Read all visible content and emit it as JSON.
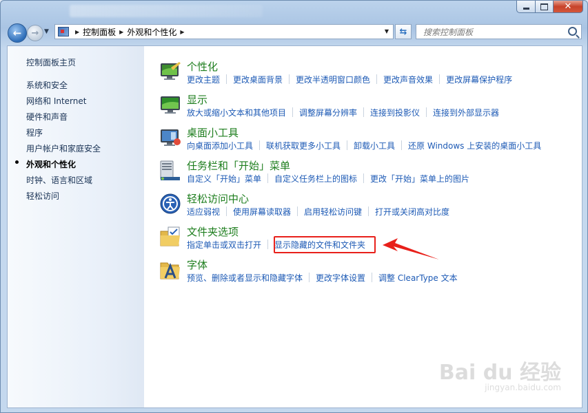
{
  "address": {
    "crumbs": [
      "控制面板",
      "外观和个性化"
    ]
  },
  "search": {
    "placeholder": "搜索控制面板"
  },
  "sidebar": {
    "home": "控制面板主页",
    "items": [
      "系统和安全",
      "网络和 Internet",
      "硬件和声音",
      "程序",
      "用户帐户和家庭安全",
      "外观和个性化",
      "时钟、语言和区域",
      "轻松访问"
    ],
    "active_index": 5
  },
  "categories": [
    {
      "title": "个性化",
      "icon": "personalization-icon",
      "links": [
        "更改主题",
        "更改桌面背景",
        "更改半透明窗口颜色",
        "更改声音效果",
        "更改屏幕保护程序"
      ]
    },
    {
      "title": "显示",
      "icon": "display-icon",
      "links": [
        "放大或缩小文本和其他项目",
        "调整屏幕分辨率",
        "连接到投影仪",
        "连接到外部显示器"
      ]
    },
    {
      "title": "桌面小工具",
      "icon": "gadgets-icon",
      "links": [
        "向桌面添加小工具",
        "联机获取更多小工具",
        "卸载小工具",
        "还原 Windows 上安装的桌面小工具"
      ]
    },
    {
      "title": "任务栏和「开始」菜单",
      "icon": "taskbar-icon",
      "links": [
        "自定义「开始」菜单",
        "自定义任务栏上的图标",
        "更改「开始」菜单上的图片"
      ]
    },
    {
      "title": "轻松访问中心",
      "icon": "ease-of-access-icon",
      "links": [
        "适应弱视",
        "使用屏幕读取器",
        "启用轻松访问键",
        "打开或关闭高对比度"
      ]
    },
    {
      "title": "文件夹选项",
      "icon": "folder-options-icon",
      "links": [
        "指定单击或双击打开",
        "显示隐藏的文件和文件夹"
      ]
    },
    {
      "title": "字体",
      "icon": "fonts-icon",
      "links": [
        "预览、删除或者显示和隐藏字体",
        "更改字体设置",
        "调整 ClearType 文本"
      ]
    }
  ],
  "watermark": {
    "brand": "Bai du 经验",
    "url": "jingyan.baidu.com"
  },
  "colors": {
    "link": "#1d5ab5",
    "category_title": "#1e7e1e",
    "highlight": "#e8201a"
  }
}
